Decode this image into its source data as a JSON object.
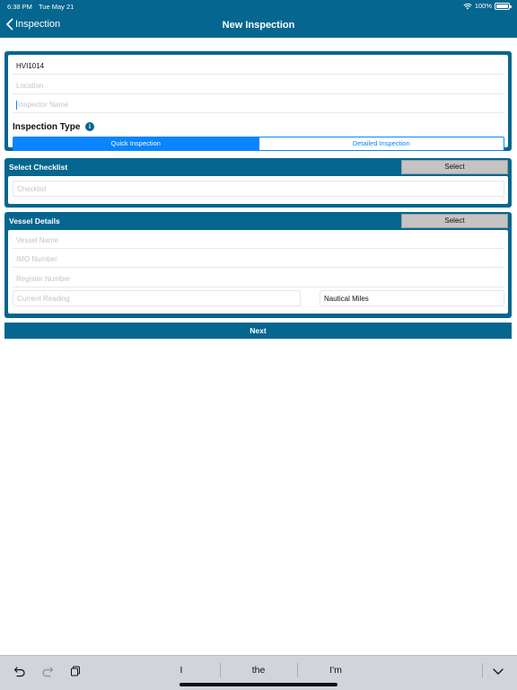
{
  "status_bar": {
    "time": "6:38 PM",
    "date": "Tue May 21",
    "battery": "100%"
  },
  "nav": {
    "back_label": "Inspection",
    "title": "New Inspection"
  },
  "inspection": {
    "id_value": "HVI1014",
    "location_placeholder": "Location",
    "inspector_placeholder": "Inspector Name",
    "type_label": "Inspection Type",
    "info_glyph": "i",
    "segments": [
      "Quick Inspection",
      "Detailed Inspection"
    ],
    "selected_segment": "Quick Inspection"
  },
  "checklist": {
    "title": "Select Checklist",
    "select_label": "Select",
    "checklist_placeholder": "Checklist"
  },
  "vessel": {
    "title": "Vessel Details",
    "select_label": "Select",
    "vessel_name_placeholder": "Vessel Name",
    "imo_placeholder": "IMO Number",
    "register_placeholder": "Register Number",
    "reading_placeholder": "Current Reading",
    "unit_value": "Nautical Miles"
  },
  "next_label": "Next",
  "keyboard": {
    "suggestions": [
      "I",
      "the",
      "I'm"
    ]
  },
  "colors": {
    "primary": "#05668f",
    "accent": "#0a84ff",
    "select_button": "#c4c4c4"
  }
}
